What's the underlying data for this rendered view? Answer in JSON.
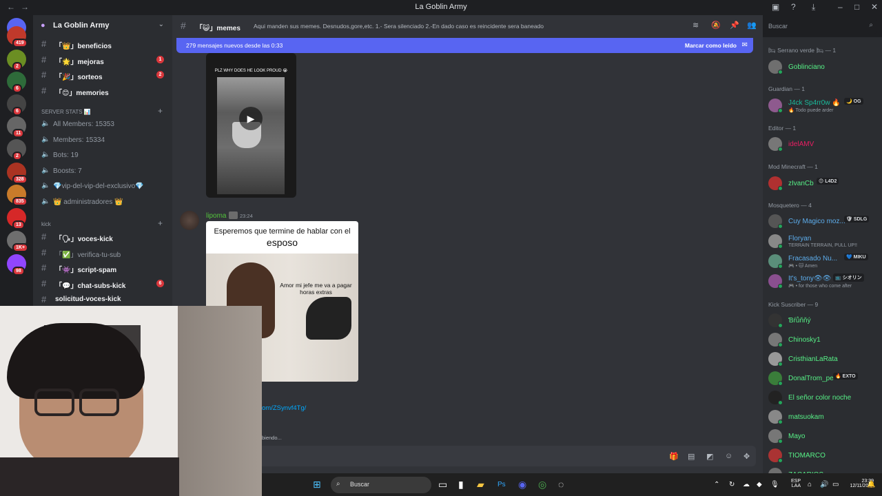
{
  "window": {
    "title": "La Goblin Army",
    "back": "←",
    "forward": "→"
  },
  "server": {
    "name": "La Goblin Army"
  },
  "guild_badges": [
    "419",
    "2",
    "6",
    "6",
    "11",
    "2",
    "328",
    "835",
    "13",
    "1K+",
    "98"
  ],
  "channels": [
    {
      "label": "「👑」beneficios",
      "badge": ""
    },
    {
      "label": "「🌟」mejoras",
      "badge": "1"
    },
    {
      "label": "「🎉」sorteos",
      "badge": "2"
    },
    {
      "label": "「😊」memories",
      "badge": ""
    }
  ],
  "stats_category": "SERVER STATS 📊",
  "stats": [
    "All Members: 15353",
    "Members: 15334",
    "Bots: 19",
    "Boosts: 7",
    "💎vip-del-vip-del-exclusivo💎",
    "👑 administradores 👑"
  ],
  "kick_category": "kick",
  "kick_channels": [
    {
      "label": "「🗣」voces-kick",
      "badge": "",
      "dim": false
    },
    {
      "label": "「✅」verifica-tu-sub",
      "badge": "",
      "dim": true
    },
    {
      "label": "「👾」script-spam",
      "badge": "",
      "dim": false
    },
    {
      "label": "「💬」chat-subs-kick",
      "badge": "6",
      "dim": false
    },
    {
      "label": "solicitud-voces-kick",
      "badge": "",
      "dim": false
    }
  ],
  "chat": {
    "channel_name": "「😺」memes",
    "topic": "Aqui manden sus memes. Desnudos,gore,etc. 1.- Sera silenciado 2.-En dado caso es reincidente sera baneado",
    "new_messages": "279 mensajes nuevos desde las 0:33",
    "mark_read": "Marcar como leído",
    "video_caption": "PLZ WHY DOES HE LOOK PROUD 😭",
    "msg_author": "lipoma",
    "msg_time": "23:24",
    "meme_line1": "Esperemos que termine de hablar con el",
    "meme_line2": "esposo",
    "meme_line3": "Amor mi jefe me va a pagar horas extras",
    "link_fragment": "om/ZSynvf4Tg/",
    "typing": "biendo..."
  },
  "search": {
    "placeholder": "Buscar"
  },
  "members": {
    "groups": [
      {
        "title": "🛏 Serrano verde 🛏 — 1",
        "people": [
          {
            "name": "Goblinciano",
            "color": "#57f287",
            "sub": "",
            "tag": ""
          }
        ]
      },
      {
        "title": "Guardian — 1",
        "people": [
          {
            "name": "J4ck Sp4rr0w 🔥",
            "color": "#1abc9c",
            "sub": "🔥 Todo puede arder",
            "tag": "🌙 OG"
          }
        ]
      },
      {
        "title": "Editor — 1",
        "people": [
          {
            "name": "idelAMV",
            "color": "#e91e63",
            "sub": "",
            "tag": ""
          }
        ]
      },
      {
        "title": "Mod Minecraft — 1",
        "people": [
          {
            "name": "zIvanCb",
            "color": "#57f287",
            "sub": "",
            "tag": "😊 L4D2"
          }
        ]
      },
      {
        "title": "Mosquetero — 4",
        "people": [
          {
            "name": "Cuy Magico moz...",
            "color": "#5dadec",
            "sub": "",
            "tag": "🛡 SDLG"
          },
          {
            "name": "Floryan",
            "color": "#5dadec",
            "sub": "TERRAIN TERRAIN, PULL UP!!",
            "tag": ""
          },
          {
            "name": "Fracasado Nu...",
            "color": "#5dadec",
            "sub": "🎮 • 🐱 Amen",
            "tag": "💙 MIKU"
          },
          {
            "name": "It's_tony👁👁",
            "color": "#5dadec",
            "sub": "🎮 • for those who come after",
            "tag": "📺 シオリン"
          }
        ]
      },
      {
        "title": "Kick Suscriber — 9",
        "people": [
          {
            "name": "Ɓŕůňňý",
            "color": "#57f287",
            "sub": "",
            "tag": ""
          },
          {
            "name": "Chinosky1",
            "color": "#57f287",
            "sub": "",
            "tag": ""
          },
          {
            "name": "CristhianLaRata",
            "color": "#57f287",
            "sub": "",
            "tag": ""
          },
          {
            "name": "DonalTrom_pe",
            "color": "#57f287",
            "sub": "",
            "tag": "🔥 EXTO"
          },
          {
            "name": "El señor color noche",
            "color": "#57f287",
            "sub": "",
            "tag": ""
          },
          {
            "name": "matsuokam",
            "color": "#57f287",
            "sub": "",
            "tag": ""
          },
          {
            "name": "Mayo",
            "color": "#57f287",
            "sub": "",
            "tag": ""
          },
          {
            "name": "TIOMARCO",
            "color": "#57f287",
            "sub": "",
            "tag": ""
          },
          {
            "name": "ZACARIOS",
            "color": "#57f287",
            "sub": "",
            "tag": ""
          }
        ]
      }
    ]
  },
  "taskbar": {
    "search": "Buscar",
    "lang1": "ESP",
    "lang2": "LAA",
    "time": "23:39",
    "date": "12/11/2025"
  },
  "colors": {
    "accent": "#5865f2",
    "badge": "#da373c",
    "online": "#23a55a"
  }
}
